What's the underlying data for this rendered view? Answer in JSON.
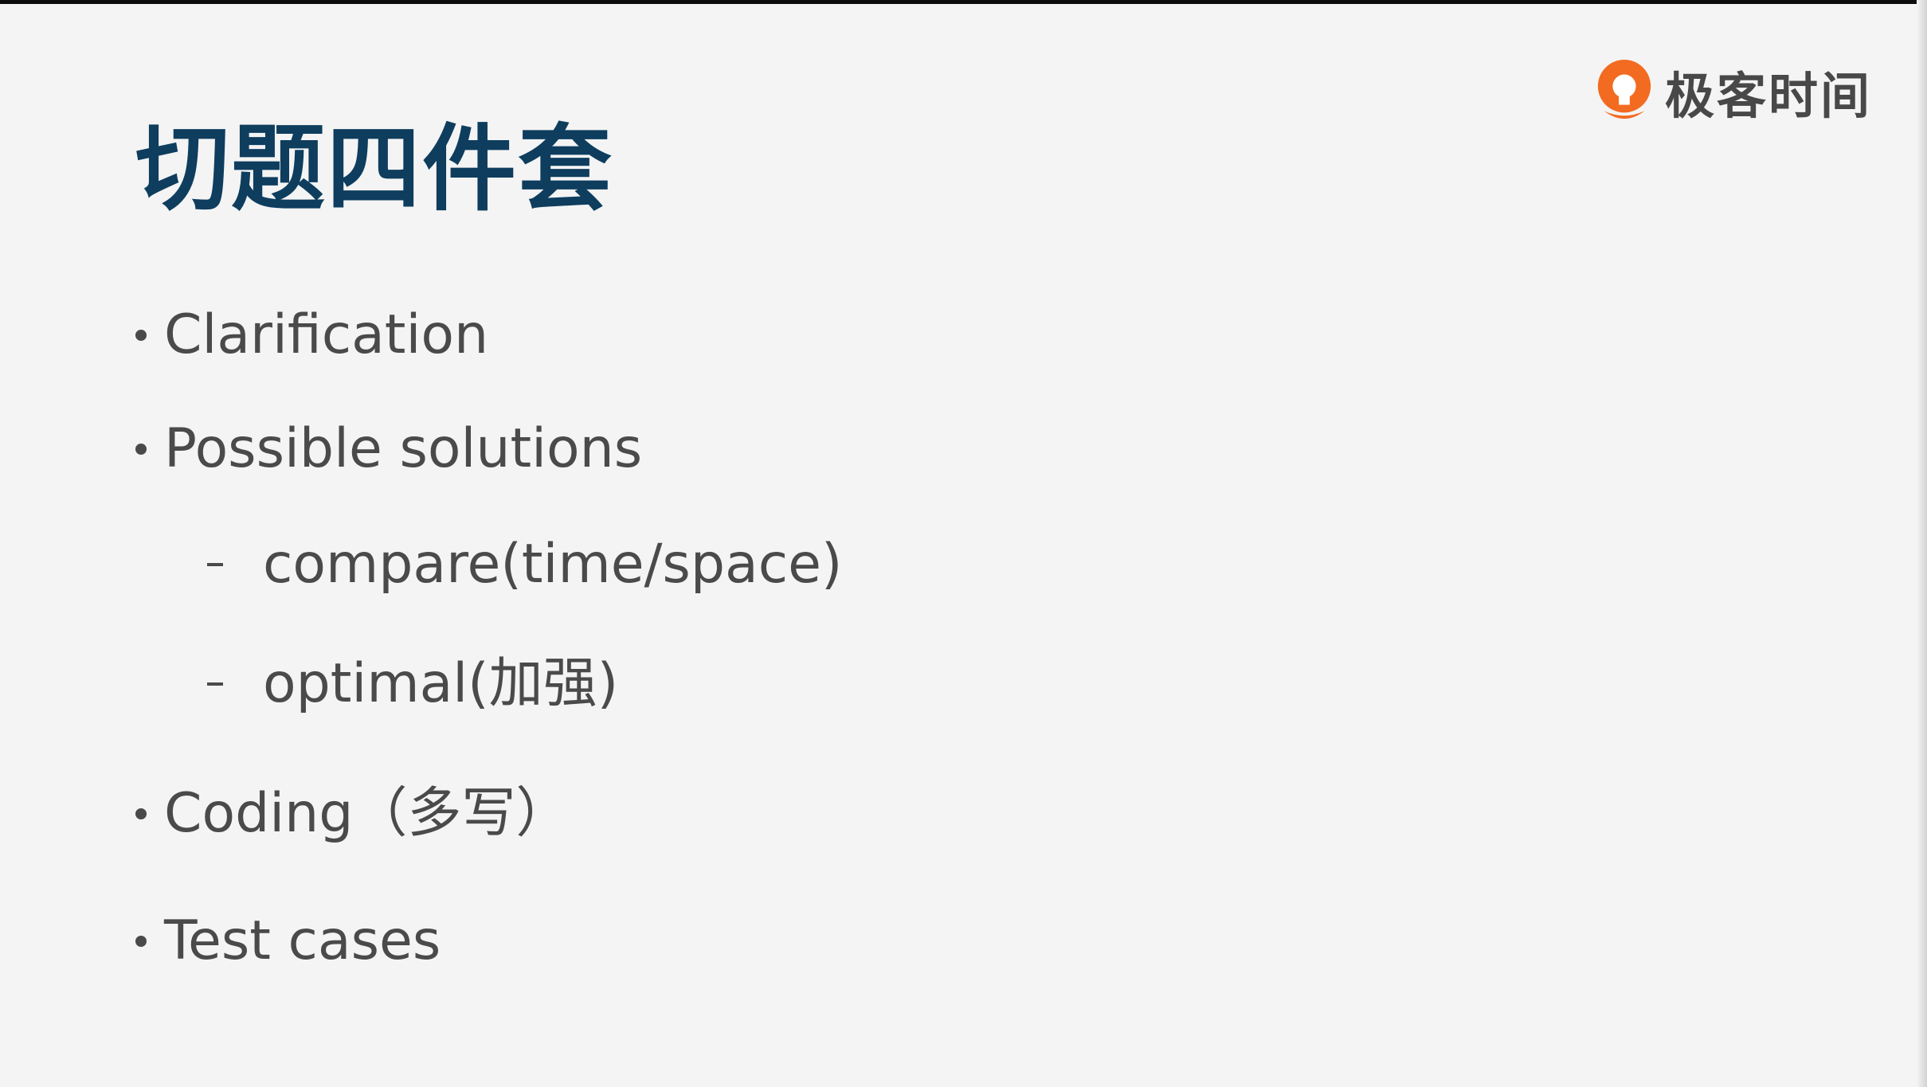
{
  "slide": {
    "title": "切题四件套",
    "brand": "极客时间",
    "bullets": [
      {
        "text": "Clarification"
      },
      {
        "text": "Possible solutions",
        "sub": [
          "compare(time/space)",
          "optimal(加强)"
        ]
      },
      {
        "text": "Coding（多写）"
      },
      {
        "text": "Test cases"
      }
    ]
  },
  "colors": {
    "title": "#0e3d5e",
    "body_text": "#4a4a4a",
    "logo_orange": "#f26b21",
    "background": "#f4f4f4"
  },
  "icons": {
    "logo": "geektime-logo-icon"
  }
}
